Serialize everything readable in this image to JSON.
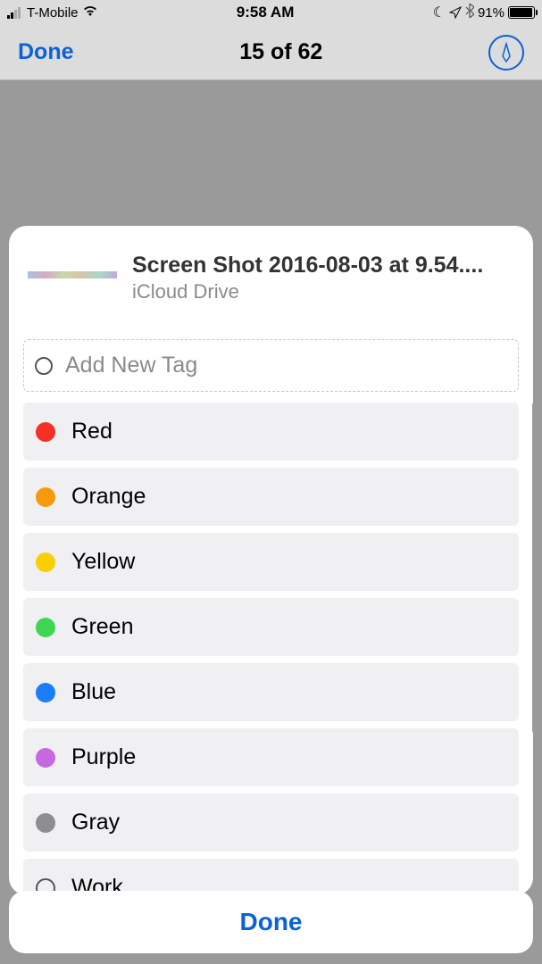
{
  "statusBar": {
    "carrier": "T-Mobile",
    "time": "9:58 AM",
    "batteryPercent": "91%"
  },
  "navBar": {
    "leftButton": "Done",
    "title": "15 of 62"
  },
  "sheet": {
    "fileName": "Screen Shot 2016-08-03 at 9.54....",
    "fileLocation": "iCloud Drive",
    "addTagPlaceholder": "Add New Tag",
    "tags": [
      {
        "label": "Red",
        "color": "#f53126"
      },
      {
        "label": "Orange",
        "color": "#f69a0b"
      },
      {
        "label": "Yellow",
        "color": "#f7cf02"
      },
      {
        "label": "Green",
        "color": "#3ed651"
      },
      {
        "label": "Blue",
        "color": "#1b7ef7"
      },
      {
        "label": "Purple",
        "color": "#c668e0"
      },
      {
        "label": "Gray",
        "color": "#8e8e92"
      },
      {
        "label": "Work",
        "color": "outline"
      }
    ]
  },
  "bottomButton": "Done"
}
